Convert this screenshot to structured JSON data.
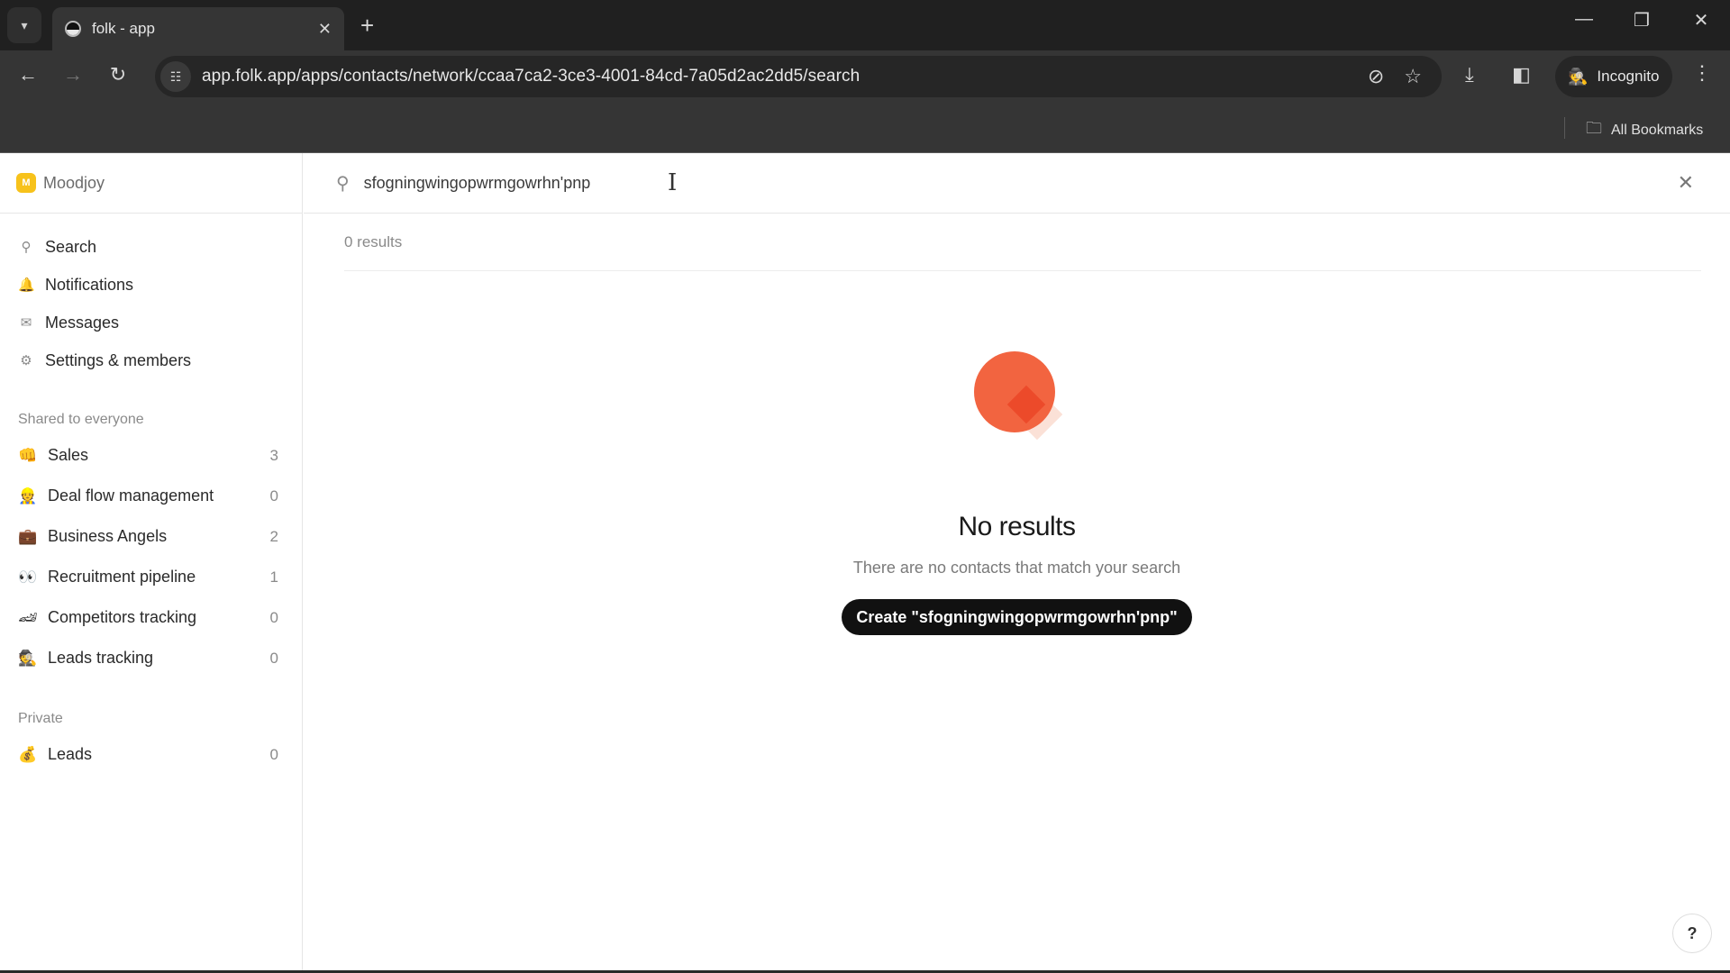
{
  "browser": {
    "tab_title": "folk - app",
    "url": "app.folk.app/apps/contacts/network/ccaa7ca2-3ce3-4001-84cd-7a05d2ac2dd5/search",
    "incognito_label": "Incognito",
    "bookmarks_label": "All Bookmarks",
    "icons": {
      "tab_search": "▾",
      "tab_close": "✕",
      "new_tab": "+",
      "minimize": "—",
      "restore": "❐",
      "close": "✕",
      "back": "←",
      "forward": "→",
      "reload": "↻",
      "site_info": "☷",
      "eye_off": "⊘",
      "star": "☆",
      "download": "⤓",
      "side_panel": "◧",
      "incognito": "🕵",
      "menu": "⋮",
      "folder": "🗀"
    }
  },
  "sidebar": {
    "workspace": {
      "logo": "M",
      "name": "Moodjoy"
    },
    "nav": [
      {
        "icon": "⚲",
        "label": "Search"
      },
      {
        "icon": "🔔",
        "label": "Notifications"
      },
      {
        "icon": "✉",
        "label": "Messages"
      },
      {
        "icon": "⚙",
        "label": "Settings & members"
      }
    ],
    "shared_title": "Shared to everyone",
    "shared": [
      {
        "emoji": "👊",
        "label": "Sales",
        "count": "3"
      },
      {
        "emoji": "👷",
        "label": "Deal flow management",
        "count": "0"
      },
      {
        "emoji": "💼",
        "label": "Business Angels",
        "count": "2"
      },
      {
        "emoji": "👀",
        "label": "Recruitment pipeline",
        "count": "1"
      },
      {
        "emoji": "🏎",
        "label": "Competitors tracking",
        "count": "0"
      },
      {
        "emoji": "🕵",
        "label": "Leads tracking",
        "count": "0"
      }
    ],
    "private_title": "Private",
    "private": [
      {
        "emoji": "💰",
        "label": "Leads",
        "count": "0"
      }
    ]
  },
  "search": {
    "icon": "⚲",
    "value": "sfogningwingopwrmgowrhn'pnp",
    "placeholder": "",
    "clear_icon": "✕",
    "results_count": "0 results"
  },
  "empty_state": {
    "title": "No results",
    "subtitle": "There are no contacts that match your search",
    "create_button": "Create \"sfogningwingopwrmgowrhn'pnp\"",
    "colors": {
      "circle": "#f26440",
      "diamond": "#ec4a2a",
      "shadow": "#fbe1d7"
    }
  },
  "help_label": "?"
}
